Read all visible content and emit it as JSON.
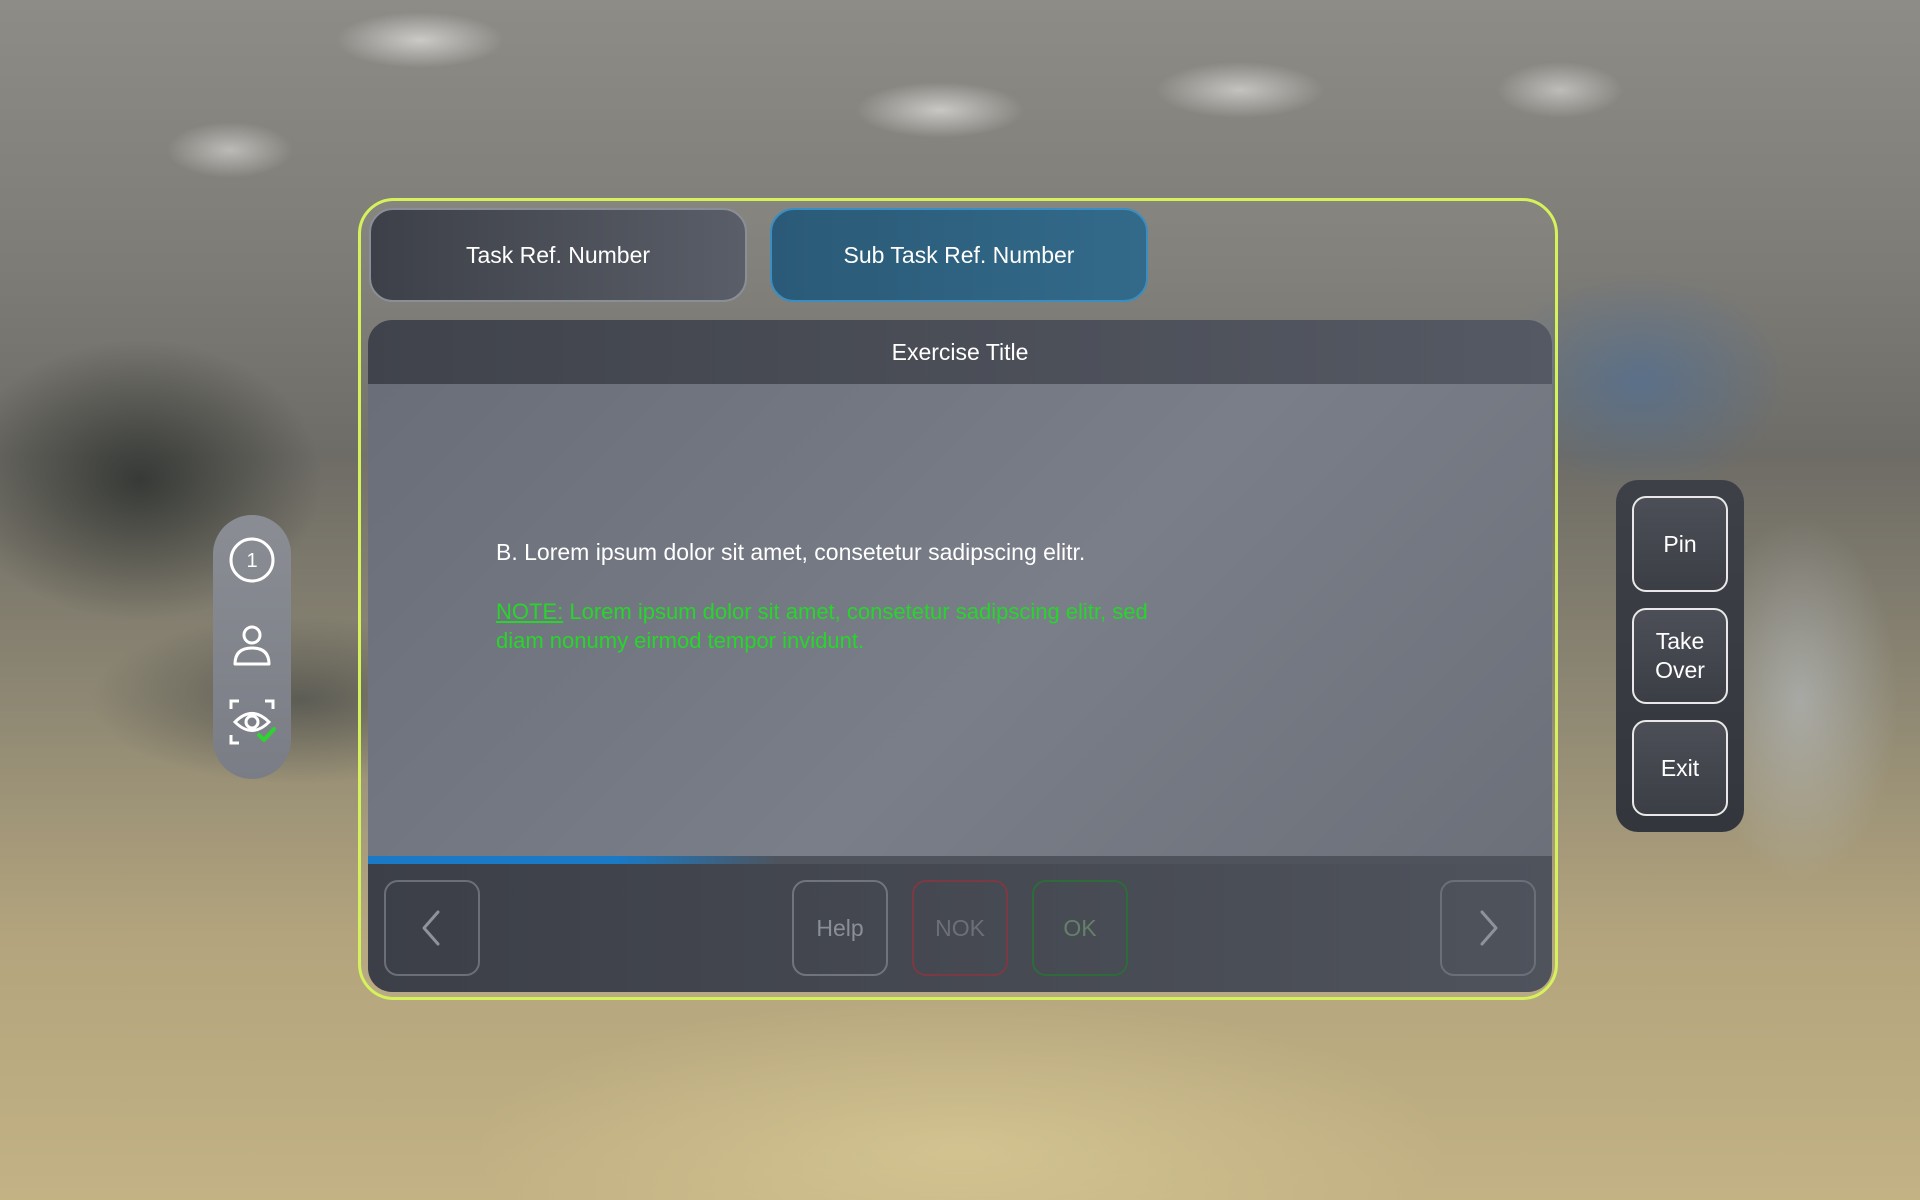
{
  "tabs": {
    "task_ref": "Task Ref. Number",
    "sub_task_ref": "Sub Task Ref. Number"
  },
  "panel": {
    "title": "Exercise Title",
    "body_text": "B. Lorem ipsum dolor sit amet, consetetur sadipscing elitr.",
    "note_label": "NOTE:",
    "note_text": " Lorem ipsum dolor sit amet, consetetur sadipscing elitr, sed diam nonumy eirmod tempor invidunt.",
    "progress_fraction": 0.35
  },
  "footer": {
    "help_label": "Help",
    "nok_label": "NOK",
    "ok_label": "OK",
    "prev_icon": "chevron-left-icon",
    "next_icon": "chevron-right-icon"
  },
  "side_left": {
    "step_number": "1",
    "icons": [
      "step-number-icon",
      "user-icon",
      "eye-tracking-check-icon"
    ]
  },
  "side_right": {
    "pin_label": "Pin",
    "take_over_label": "Take Over",
    "exit_label": "Exit"
  },
  "colors": {
    "frame_border": "#d6f25b",
    "active_tab": "#336a8a",
    "note_green": "#27d62a",
    "progress_blue": "#1a7ac6",
    "check_green": "#2fd32f"
  }
}
